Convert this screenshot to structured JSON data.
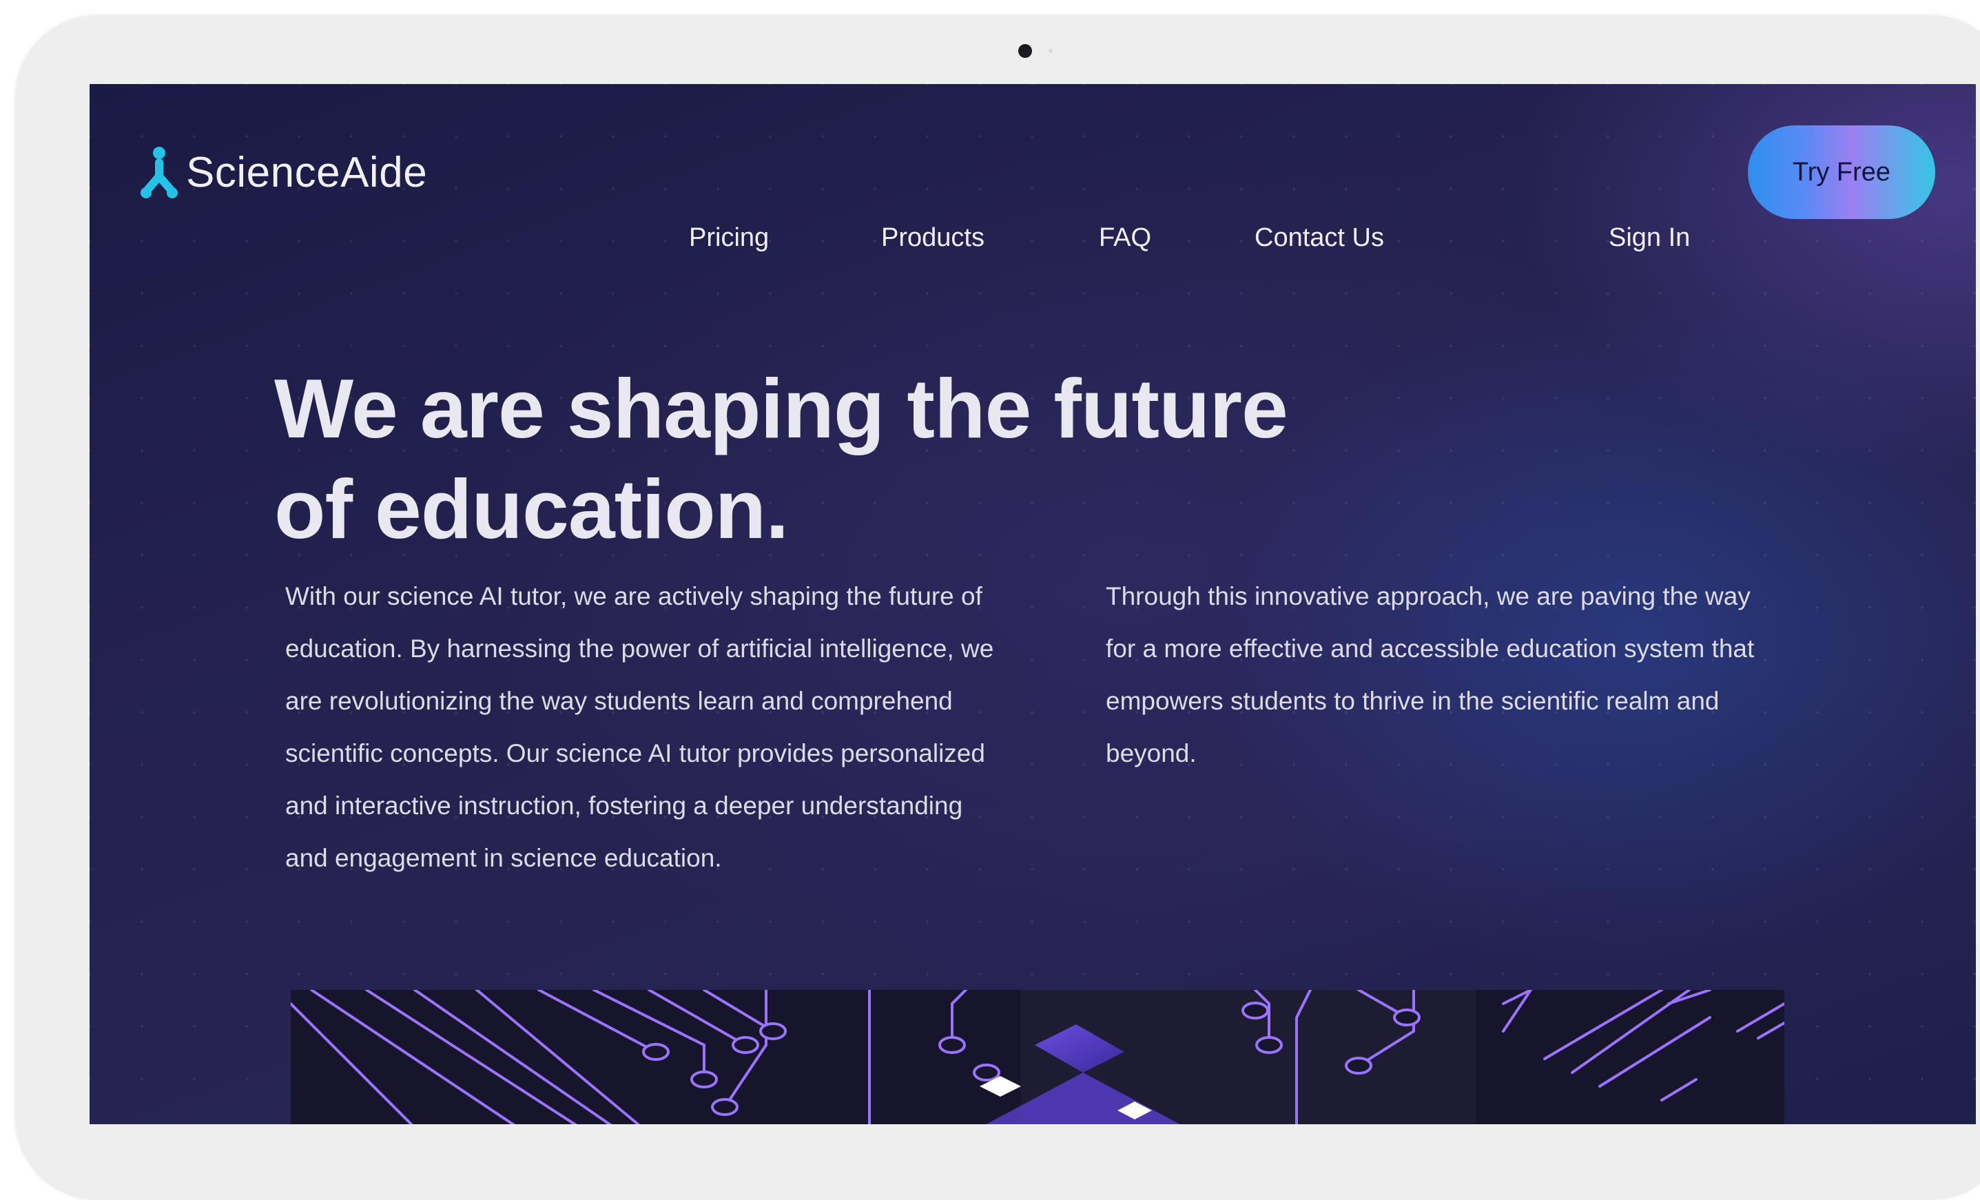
{
  "brand": {
    "name_part1": "Science",
    "name_part2": "Aide"
  },
  "nav": {
    "links": [
      "Pricing",
      "Products",
      "FAQ",
      "Contact Us"
    ],
    "sign_in": "Sign In",
    "try_free": "Try Free"
  },
  "hero": {
    "headline_line1": "We are shaping the future",
    "headline_line2": "of education.",
    "paragraph_left": "With our science AI tutor, we are actively shaping the future of education. By harnessing the power of artificial intelligence, we are revolutionizing the way students learn and comprehend scientific concepts. Our science AI tutor provides personalized and interactive instruction, fostering a deeper understanding and engagement in science education.",
    "paragraph_right": "Through this innovative approach, we are paving the way for a more effective and accessible education system that empowers students to thrive in the scientific realm and beyond."
  },
  "colors": {
    "background": "#25224f",
    "logo_accent": "#22c3e6",
    "button_gradient_start": "#2d8ff0",
    "button_gradient_end": "#36c6e6",
    "circuit_line": "#8f6cff"
  },
  "icons": {
    "logo": "person-logo-icon",
    "hero_image": "circuit-board-image"
  }
}
